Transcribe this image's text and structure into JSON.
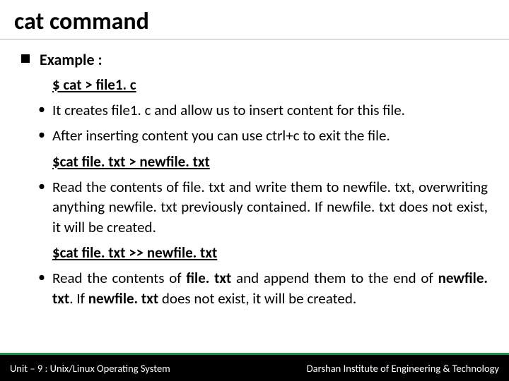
{
  "title": {
    "bold": "cat",
    "rest": " command"
  },
  "example_label": "Example :",
  "cmd1": "$ cat  > file1. c",
  "point1": "It creates file1. c and allow us to insert content for this file.",
  "point2": "After inserting content you can use ctrl+c to exit the file.",
  "cmd2": "$cat file. txt > newfile. txt",
  "point3_a": "Read the contents of file. txt and write them to newfile. txt, overwriting anything newfile. txt previously contained. If newfile. txt does not exist, it will be created.",
  "cmd3": "$cat file. txt >> newfile. txt",
  "point4_pre": "Read the contents of ",
  "point4_b1": "file. txt ",
  "point4_mid1": "and append them to the end of ",
  "point4_b2": "newfile. txt",
  "point4_mid2": ". If ",
  "point4_b3": "newfile. txt ",
  "point4_end": "does not exist, it will be created.",
  "footer_left": "Unit – 9  : Unix/Linux Operating System",
  "footer_right": "Darshan Institute of Engineering & Technology"
}
